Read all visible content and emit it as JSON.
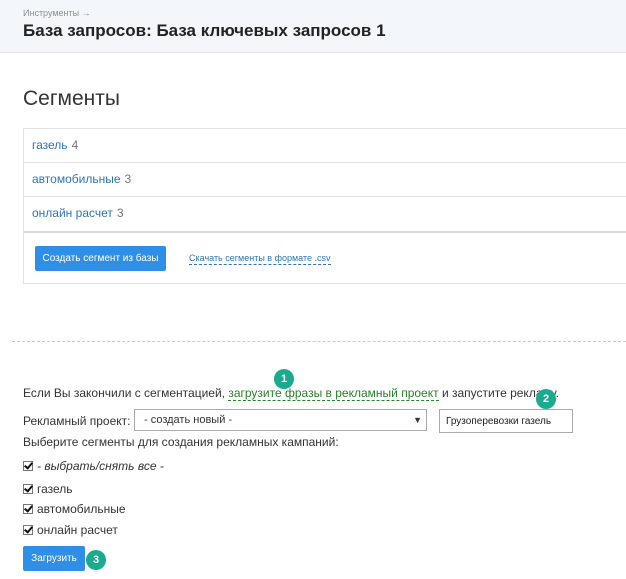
{
  "header": {
    "breadcrumb": "Инструменты →",
    "title": "База запросов: База ключевых запросов 1"
  },
  "segments": {
    "title": "Сегменты",
    "items": [
      {
        "name": "газель",
        "count": "4"
      },
      {
        "name": "автомобильные",
        "count": "3"
      },
      {
        "name": "онлайн расчет",
        "count": "3"
      }
    ],
    "create_button": "Создать сегмент из базы",
    "csv_link": "Скачать сегменты в формате .csv"
  },
  "upload": {
    "info_before": "Если Вы закончили с сегментацией, ",
    "info_link": "загрузите фразы в рекламный проект",
    "info_after": " и запустите рекламу.",
    "project_label": "Рекламный проект:",
    "project_select": "- создать новый -",
    "project_name_value": "Грузоперевозки газель",
    "choose_label": "Выберите сегменты для создания рекламных кампаний:",
    "checkboxes": [
      {
        "label": "- выбрать/снять все -",
        "checked": true
      },
      {
        "label": "газель",
        "checked": true
      },
      {
        "label": "автомобильные",
        "checked": true
      },
      {
        "label": "онлайн расчет",
        "checked": true
      }
    ],
    "upload_button": "Загрузить"
  },
  "badges": [
    "1",
    "2",
    "3"
  ],
  "colors": {
    "accent_blue": "#2f8fe6",
    "link_blue": "#2f74b5",
    "link_green": "#2a7d2a",
    "badge_teal": "#1aaa8f",
    "header_bg": "#f3f7fc"
  }
}
